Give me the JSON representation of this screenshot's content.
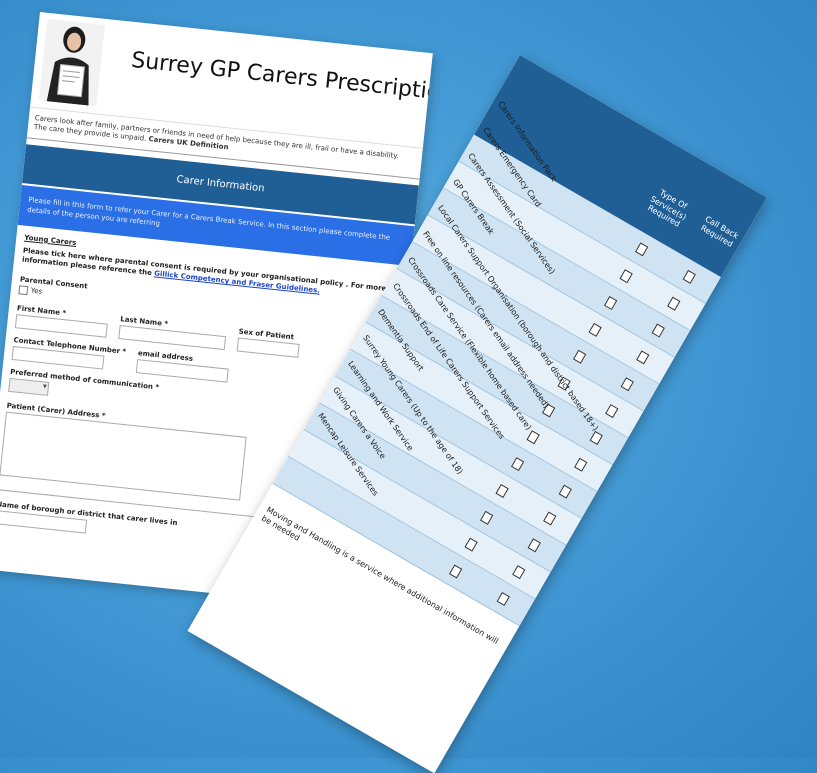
{
  "form": {
    "title": "Surrey GP Carers Prescription",
    "definition_text": "Carers look after family, partners or friends in need of help because they are ill, frail or have a disability. The care they provide is unpaid.",
    "definition_source": "Carers UK Definition",
    "section_heading": "Carer Information",
    "intro_text": "Please fill in this form to refer your Carer for a Carers Break Service. In this section please complete the details of the person you are referring",
    "young_carers_heading": "Young Carers",
    "consent_note": "Please tick here where parental consent is required by your organisational policy . For more information please reference the",
    "consent_link": "Gillick Competency and Fraser Guidelines.",
    "parental_consent_label": "Parental Consent",
    "yes_label": "Yes",
    "first_name_label": "First Name *",
    "last_name_label": "Last Name *",
    "sex_label": "Sex of Patient",
    "contact_label": "Contact Telephone Number *",
    "email_label": "email address",
    "preferred_label": "Preferred method of communication *",
    "address_label": "Patient (Carer) Address *",
    "borough_label": "Name of borough or district that carer lives in"
  },
  "services": {
    "col_type": "Type Of Service(s) Required",
    "col_call": "Call Back Required",
    "rows": [
      "Carers Information Pack",
      "Carers Emergency Card",
      "Carers Assessment (Social Services)",
      "GP Carers Break",
      "Local Carers Support Organisation (borough and district based 18+)",
      "Free on line resources (Carers email address needed)",
      "Crossroads Care Service (Flexible home based care)",
      "Crossroads End of Life Carers Support Services",
      "Dementia Support",
      "Surrey Young Carers (Up to the age of 18)",
      "Learning and Work Service",
      "Giving Carers a Voice",
      "Mencap Leisure Services"
    ],
    "footnote": "Moving and Handling is a service where additional information will be needed"
  }
}
